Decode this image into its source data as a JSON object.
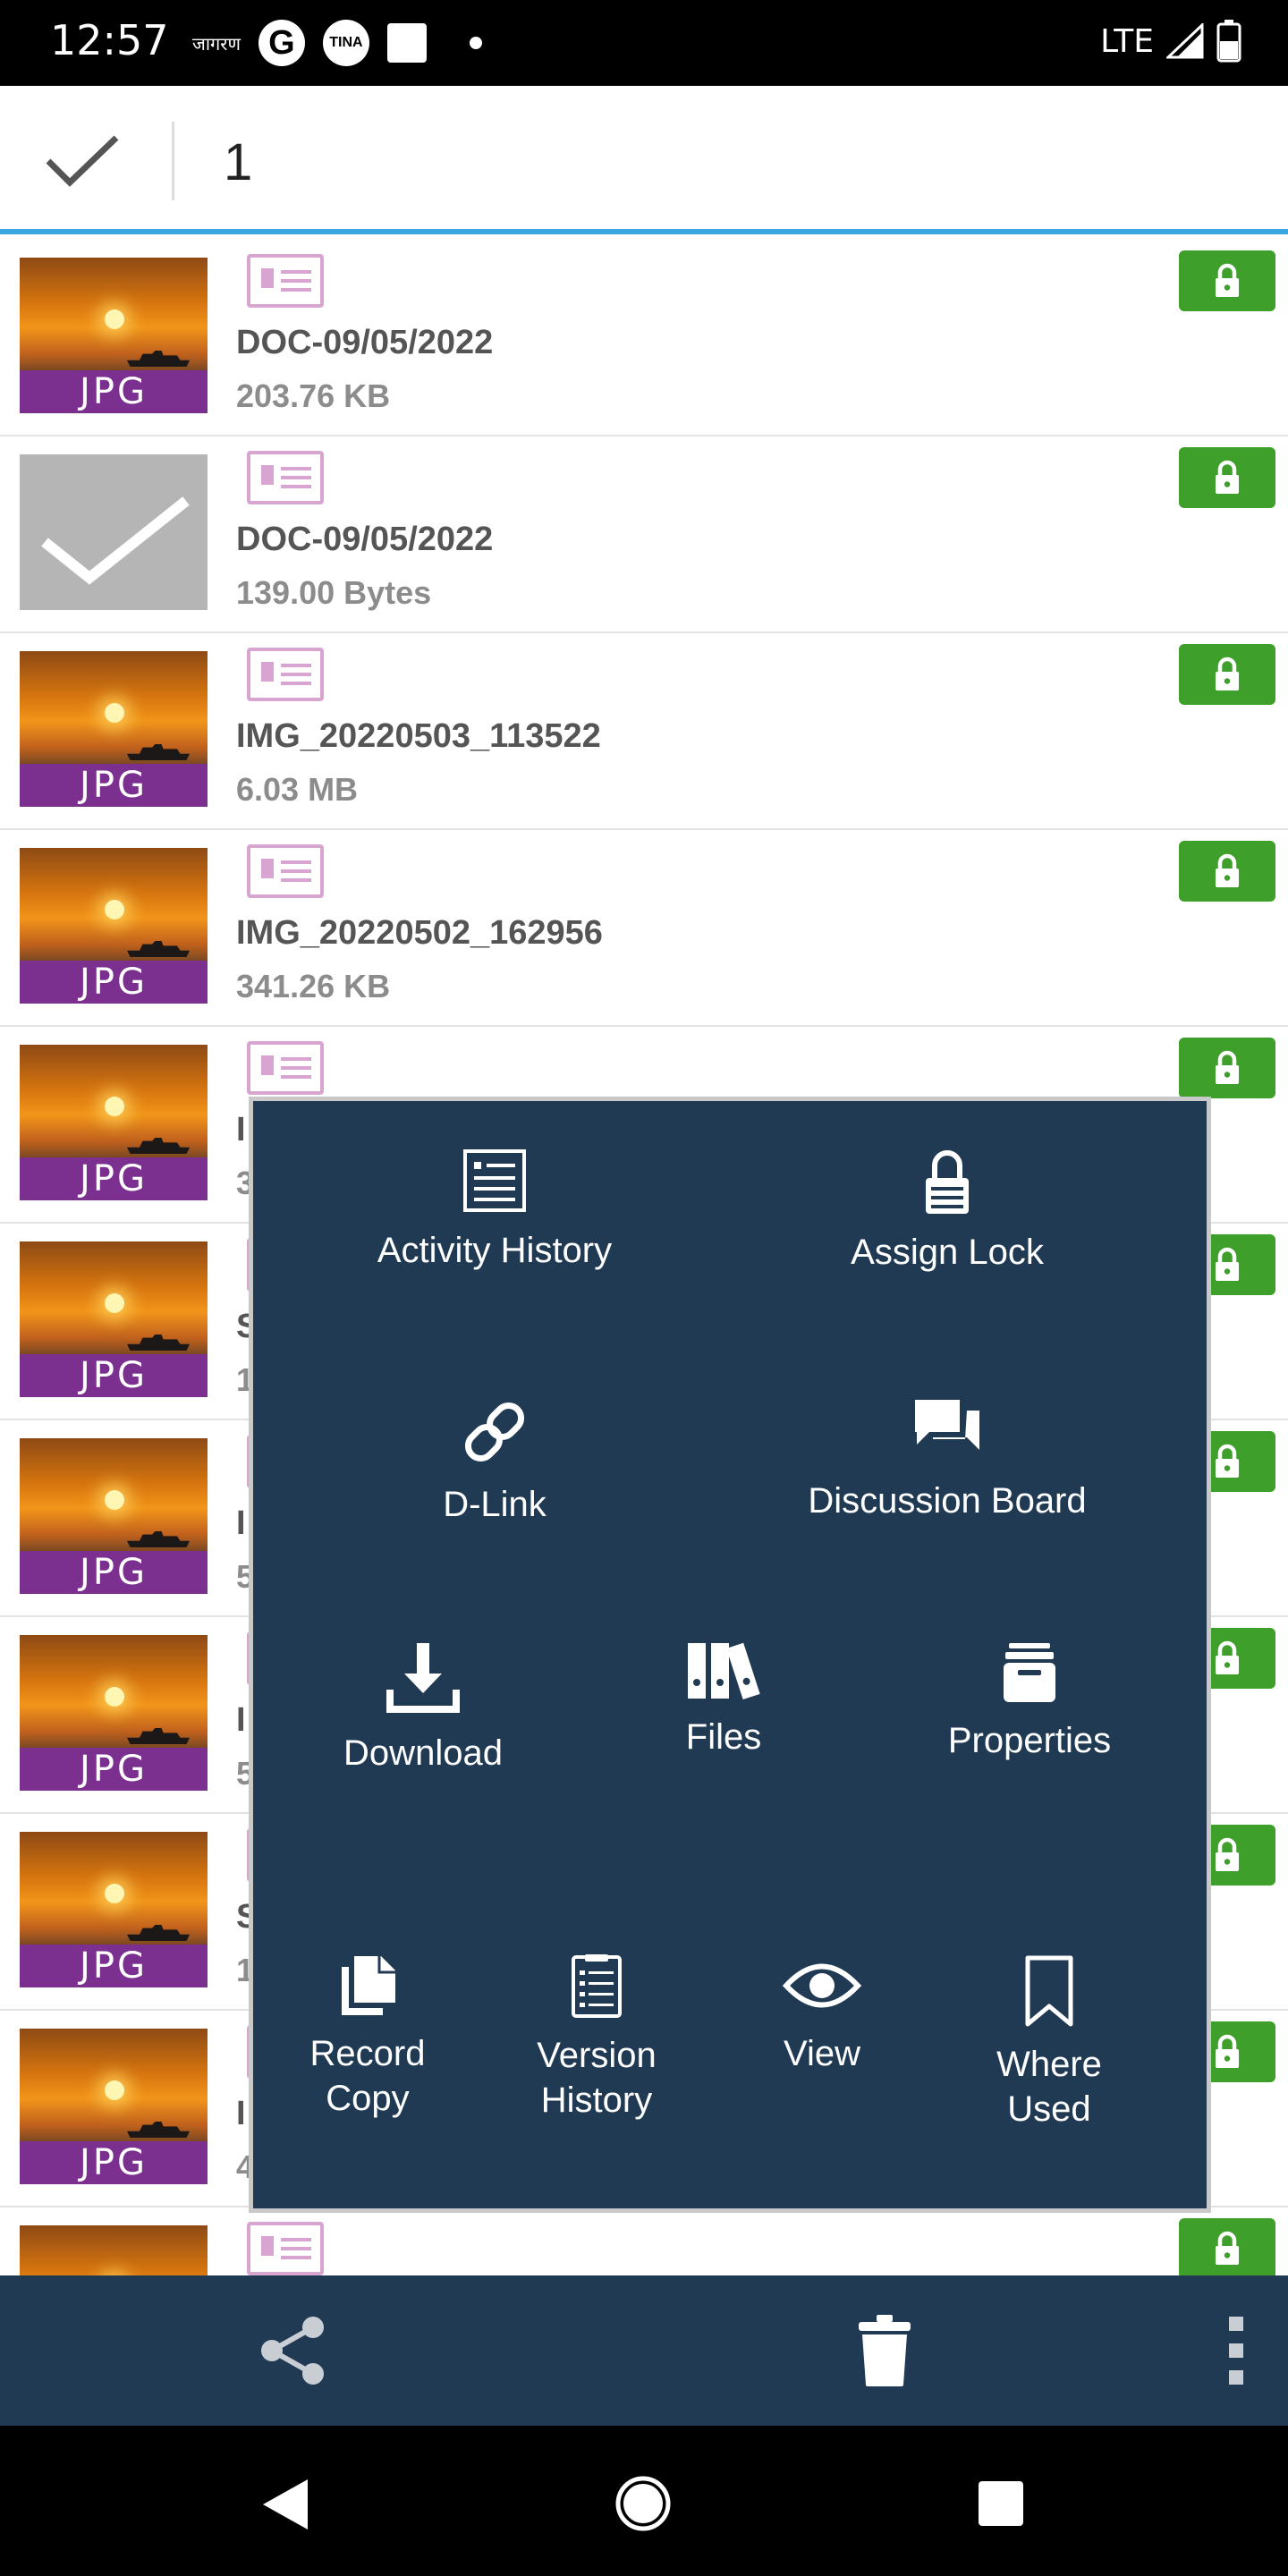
{
  "status_bar": {
    "time": "12:57",
    "app_icons": [
      "जागरण",
      "G",
      "TINA"
    ],
    "network": "LTE"
  },
  "selection_bar": {
    "count": "1"
  },
  "files": [
    {
      "name": "DOC-09/05/2022",
      "size": "203.76 KB",
      "type": "JPG",
      "selected": false
    },
    {
      "name": "DOC-09/05/2022",
      "size": "139.00 Bytes",
      "type": "JPG",
      "selected": true
    },
    {
      "name": "IMG_20220503_113522",
      "size": "6.03 MB",
      "type": "JPG",
      "selected": false
    },
    {
      "name": "IMG_20220502_162956",
      "size": "341.26 KB",
      "type": "JPG",
      "selected": false
    },
    {
      "name": "I",
      "size": "3",
      "type": "JPG",
      "selected": false
    },
    {
      "name": "S",
      "size": "1",
      "type": "JPG",
      "selected": false
    },
    {
      "name": "I",
      "size": "5",
      "type": "JPG",
      "selected": false
    },
    {
      "name": "I",
      "size": "5",
      "type": "JPG",
      "selected": false
    },
    {
      "name": "S",
      "size": "1",
      "type": "JPG",
      "selected": false
    },
    {
      "name": "I",
      "size": "4",
      "type": "JPG",
      "selected": false
    },
    {
      "name": "",
      "size": "",
      "type": "",
      "selected": false
    }
  ],
  "context_menu": {
    "activity_history": "Activity History",
    "assign_lock": "Assign Lock",
    "d_link": "D-Link",
    "discussion_board": "Discussion Board",
    "download": "Download",
    "files": "Files",
    "properties": "Properties",
    "record_copy": "Record Copy",
    "version_history": "Version History",
    "view": "View",
    "where_used": "Where Used"
  },
  "colors": {
    "menu_bg": "#213a54",
    "lock_green": "#3e9f2a",
    "jpg_badge": "#7b2f8e",
    "accent_line": "#3aa6e0"
  }
}
